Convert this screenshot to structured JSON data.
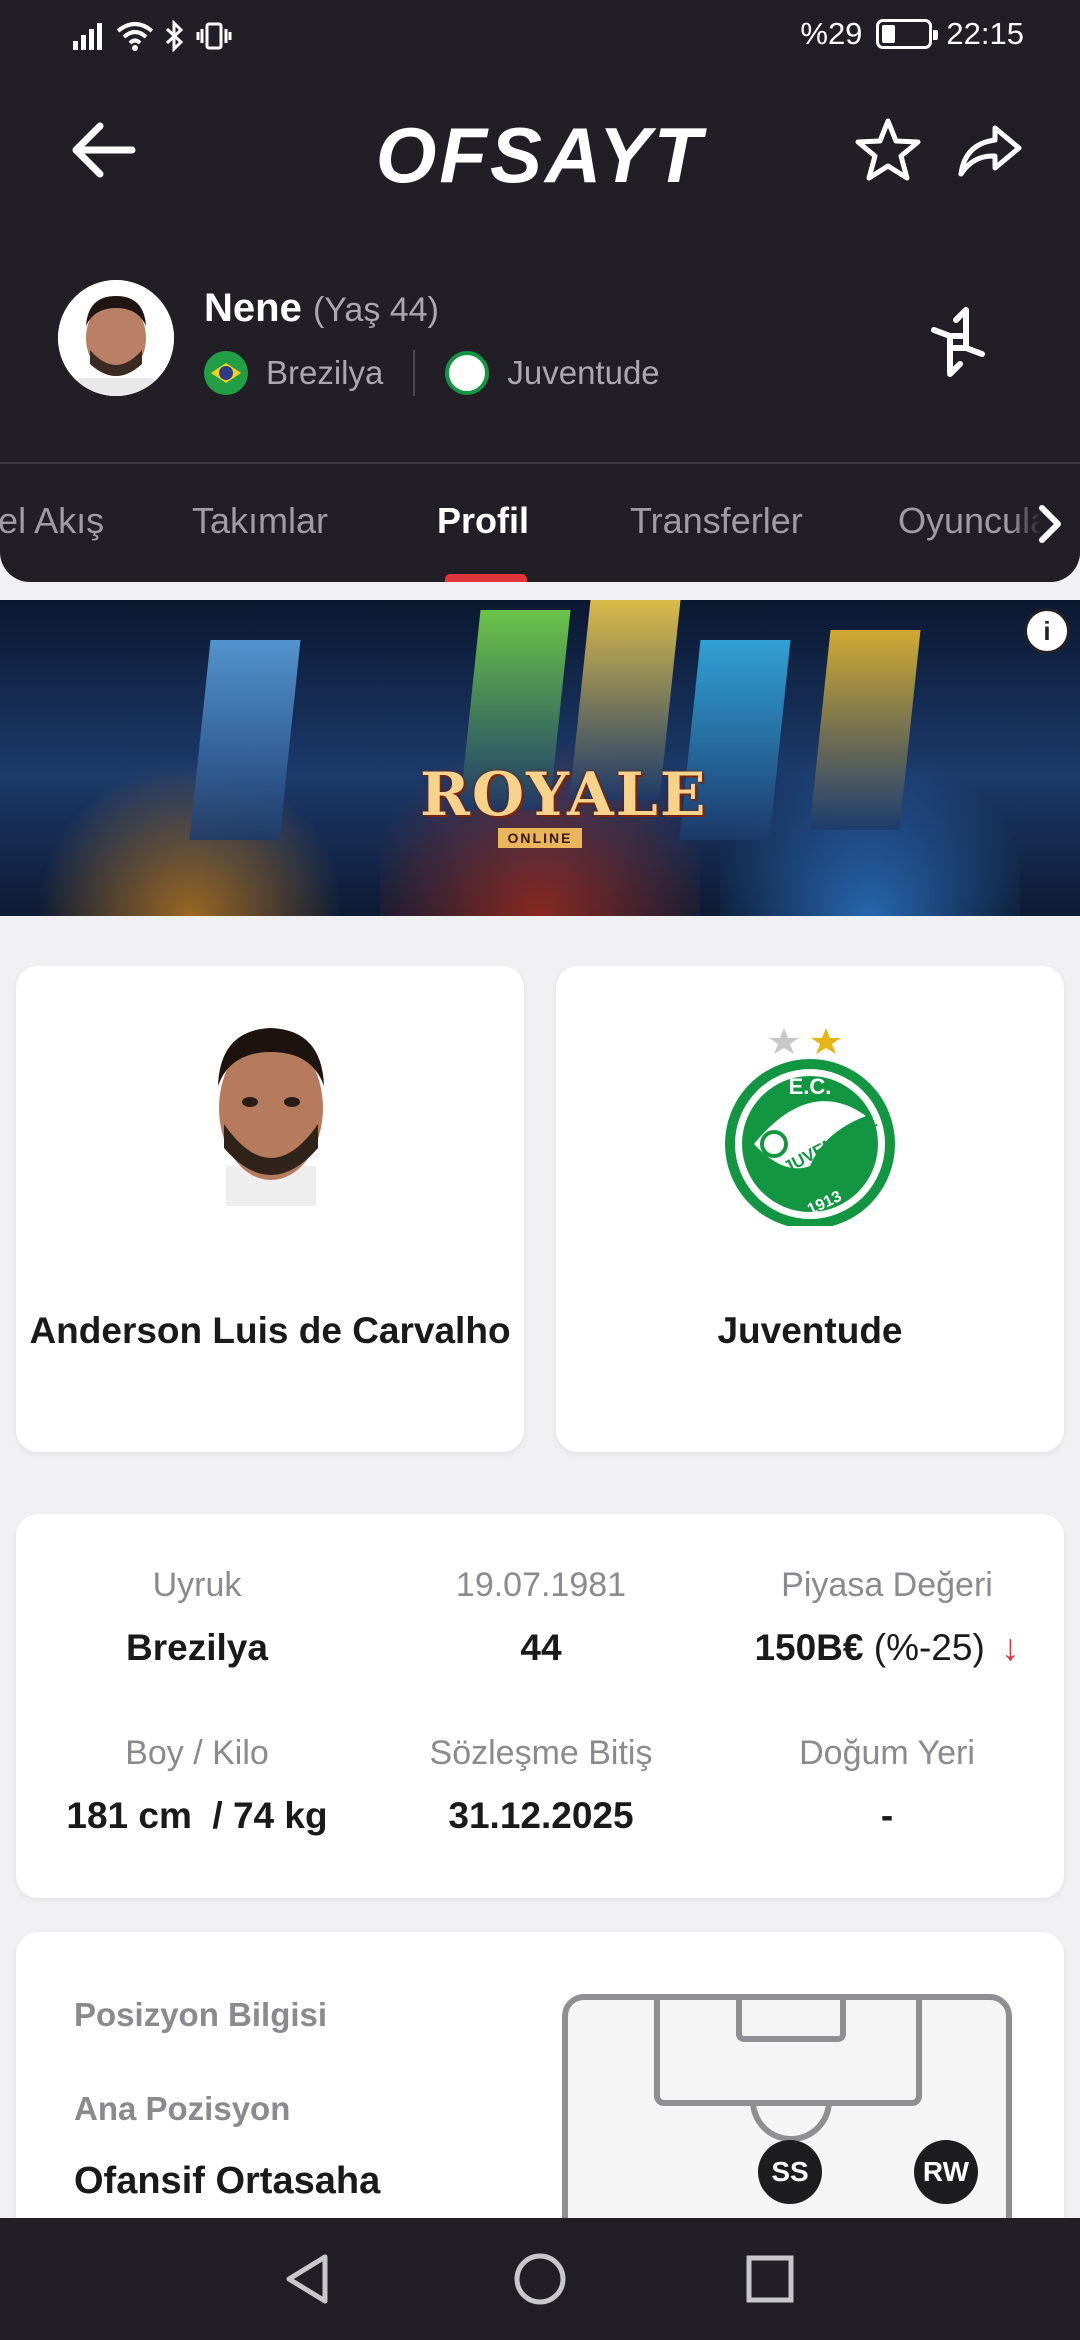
{
  "status_bar": {
    "battery_text": "%29",
    "battery_level": 0.29,
    "time": "22:15"
  },
  "header": {
    "logo_text": "OFSAYT"
  },
  "player": {
    "name": "Nene",
    "age_label": "(Yaş 44)",
    "nationality": "Brezilya",
    "club": "Juventude"
  },
  "tabs": [
    {
      "label": "Genel Akış"
    },
    {
      "label": "Takımlar"
    },
    {
      "label": "Profil",
      "active": true
    },
    {
      "label": "Transferler"
    },
    {
      "label": "Oyuncular"
    }
  ],
  "banner": {
    "title": "ROYALE",
    "subtitle": "ONLINE"
  },
  "photo_card": {
    "full_name": "Anderson Luis de Carvalho"
  },
  "club_card": {
    "name": "Juventude",
    "logo_text": "JUVENTUDE",
    "logo_initials": "E.C.",
    "logo_year": "1913"
  },
  "stats": {
    "nationality_label": "Uyruk",
    "nationality_value": "Brezilya",
    "birthdate_label": "19.07.1981",
    "age_value": "44",
    "market_label": "Piyasa Değeri",
    "market_value": "150B€",
    "market_change": "(%-25)",
    "height_weight_label": "Boy / Kilo",
    "height_weight_value": "181 cm  / 74 kg",
    "contract_label": "Sözleşme Bitiş",
    "contract_value": "31.12.2025",
    "birthplace_label": "Doğum Yeri",
    "birthplace_value": "-"
  },
  "position": {
    "heading": "Posizyon Bilgisi",
    "main_label": "Ana Pozisyon",
    "main_value": "Ofansif Ortasaha",
    "markers": [
      "SS",
      "RW"
    ]
  },
  "colors": {
    "background_dark": "#211f25",
    "accent_red": "#e2343b",
    "club_green": "#129642",
    "page_bg": "#f0f0f2"
  }
}
